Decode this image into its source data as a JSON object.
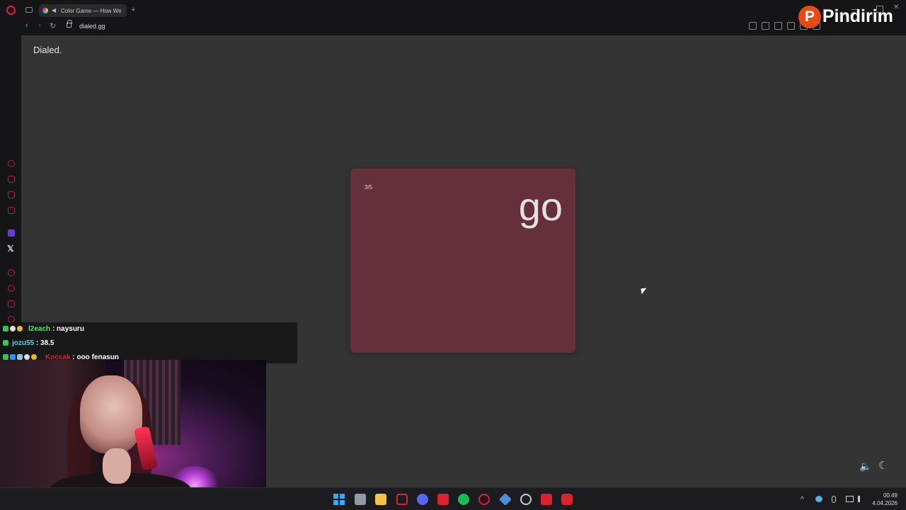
{
  "browser": {
    "tab_title": "Color Game — How We",
    "new_tab_glyph": "+",
    "url": "dialed.gg",
    "nav": {
      "back": "‹",
      "forward": "›",
      "reload": "↻"
    }
  },
  "watermark": {
    "logo_letter": "P",
    "text": "Pindirim"
  },
  "page": {
    "brand": "Dialed.",
    "card": {
      "counter": "3/5",
      "word": "go",
      "color": "#652f3c"
    },
    "controls": {
      "sound_glyph": "🔈",
      "theme_glyph": "☾"
    }
  },
  "chat": {
    "messages": [
      {
        "user": "l2each",
        "text": " : naysuru"
      },
      {
        "user": "jozu55",
        "text": " : 38.5"
      },
      {
        "user": "Koccak",
        "text": " : ooo fenasun"
      }
    ]
  },
  "sidebar": {
    "x_glyph": "𝕏"
  },
  "taskbar": {
    "time": "00:49",
    "date": "4.04.2026",
    "tray_chevron": "^"
  }
}
